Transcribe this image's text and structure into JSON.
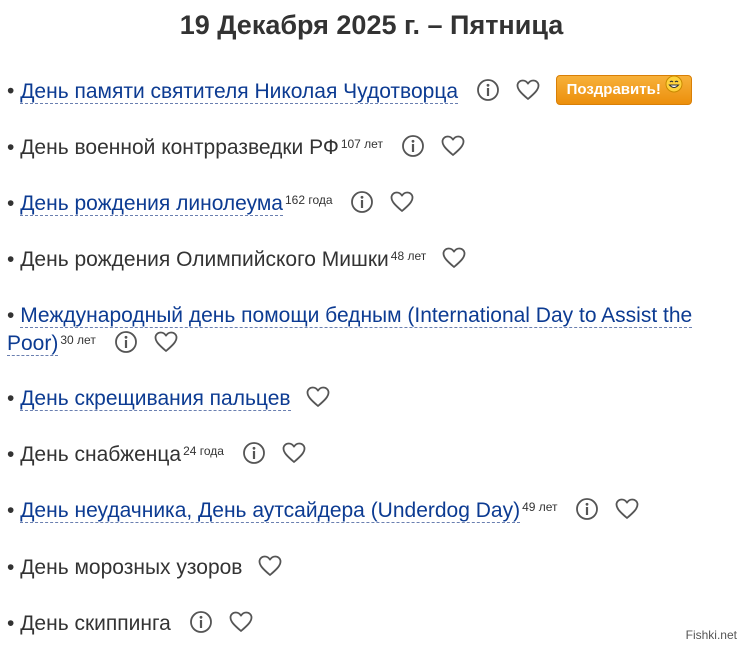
{
  "header": {
    "title": "19 Декабря 2025 г. – Пятница"
  },
  "bullet": "•",
  "items": [
    {
      "label": "День памяти святителя Николая Чудотворца",
      "age": "",
      "congrats_label": "Поздравить!"
    },
    {
      "label": "День военной контрразведки РФ",
      "age": "107 лет"
    },
    {
      "label": "День рождения линолеума",
      "age": "162 года"
    },
    {
      "label": "День рождения Олимпийского Мишки",
      "age": "48 лет"
    },
    {
      "label": "Международный день помощи бедным (International Day to Assist the Poor)",
      "age": "30 лет"
    },
    {
      "label": "День скрещивания пальцев",
      "age": ""
    },
    {
      "label": "День снабженца",
      "age": "24 года"
    },
    {
      "label": "День неудачника, День аутсайдера (Underdog Day)",
      "age": "49 лет"
    },
    {
      "label": "День морозных узоров",
      "age": ""
    },
    {
      "label": "День скиппинга",
      "age": ""
    }
  ],
  "icons": {
    "info": "info-circle-icon",
    "heart": "heart-outline-icon",
    "emoji": "smiling-face-emoji-icon"
  },
  "colors": {
    "link": "#0c3b92",
    "button": "#f0a020",
    "text": "#333333"
  },
  "watermark": "Fishki.net"
}
